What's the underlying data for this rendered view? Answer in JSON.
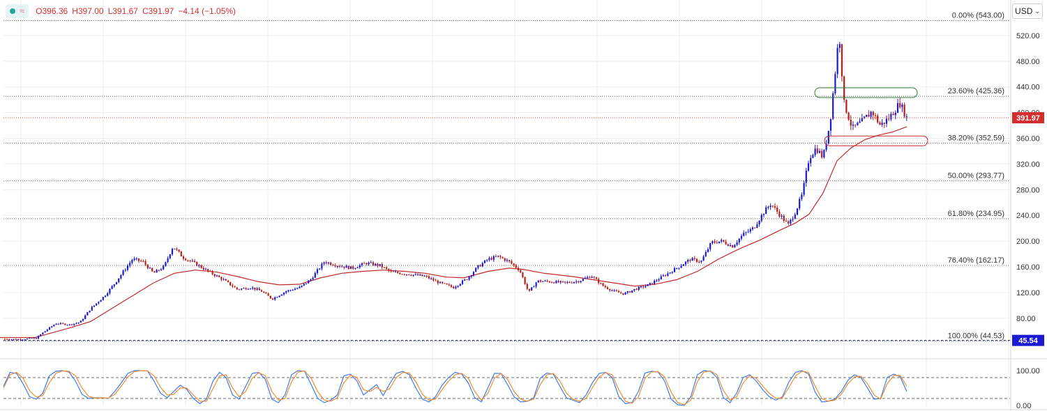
{
  "header": {
    "open": "O396.36",
    "high": "H397.00",
    "low": "L391.67",
    "close": "C391.97",
    "change": "−4.14 (−1.05%)",
    "status_icon": "green-dot-icon",
    "indicator_icon": "wave-icon"
  },
  "currency_selector": {
    "label": "USD"
  },
  "colors": {
    "up_candle": "#1a1ad4",
    "down_candle": "#b71c1c",
    "moving_average": "#c62828",
    "stoch_k": "#3d7bf0",
    "stoch_d": "#f08c2e",
    "price_line": "#d32f2f",
    "grid": "#ececec",
    "fib_line": "#6b6b6b"
  },
  "chart_data": [
    {
      "type": "candlestick",
      "ylim": [
        30,
        560
      ],
      "y_ticks": [
        "520.00",
        "480.00",
        "440.00",
        "400.00",
        "360.00",
        "320.00",
        "280.00",
        "240.00",
        "200.00",
        "160.00",
        "120.00",
        "80.00"
      ],
      "current_price": "391.97",
      "last_close_marker": "45.54",
      "fib_levels": [
        {
          "label": "0.00% (543.00)",
          "value": 543.0
        },
        {
          "label": "23.60% (425.36)",
          "value": 425.36
        },
        {
          "label": "38.20% (352.59)",
          "value": 352.59
        },
        {
          "label": "50.00% (293.77)",
          "value": 293.77
        },
        {
          "label": "61.80% (234.95)",
          "value": 234.95
        },
        {
          "label": "76.40% (162.17)",
          "value": 162.17
        },
        {
          "label": "100.00% (44.53)",
          "value": 44.53
        }
      ],
      "price_path": [
        [
          0,
          48
        ],
        [
          25,
          47
        ],
        [
          52,
          49
        ],
        [
          62,
          58
        ],
        [
          80,
          72
        ],
        [
          100,
          70
        ],
        [
          115,
          74
        ],
        [
          130,
          95
        ],
        [
          150,
          115
        ],
        [
          165,
          135
        ],
        [
          175,
          150
        ],
        [
          190,
          172
        ],
        [
          205,
          168
        ],
        [
          220,
          150
        ],
        [
          235,
          160
        ],
        [
          248,
          192
        ],
        [
          262,
          175
        ],
        [
          280,
          165
        ],
        [
          300,
          152
        ],
        [
          320,
          140
        ],
        [
          340,
          125
        ],
        [
          360,
          128
        ],
        [
          375,
          122
        ],
        [
          390,
          110
        ],
        [
          410,
          122
        ],
        [
          430,
          128
        ],
        [
          445,
          140
        ],
        [
          465,
          168
        ],
        [
          485,
          162
        ],
        [
          505,
          158
        ],
        [
          525,
          166
        ],
        [
          545,
          162
        ],
        [
          560,
          152
        ],
        [
          575,
          150
        ],
        [
          590,
          148
        ],
        [
          610,
          145
        ],
        [
          630,
          135
        ],
        [
          650,
          128
        ],
        [
          670,
          142
        ],
        [
          685,
          160
        ],
        [
          700,
          172
        ],
        [
          715,
          176
        ],
        [
          730,
          168
        ],
        [
          745,
          155
        ],
        [
          758,
          120
        ],
        [
          770,
          138
        ],
        [
          790,
          137
        ],
        [
          810,
          135
        ],
        [
          830,
          138
        ],
        [
          848,
          146
        ],
        [
          865,
          130
        ],
        [
          880,
          122
        ],
        [
          895,
          118
        ],
        [
          910,
          125
        ],
        [
          930,
          132
        ],
        [
          950,
          145
        ],
        [
          970,
          158
        ],
        [
          990,
          172
        ],
        [
          1005,
          168
        ],
        [
          1020,
          198
        ],
        [
          1035,
          200
        ],
        [
          1050,
          192
        ],
        [
          1065,
          210
        ],
        [
          1080,
          220
        ],
        [
          1095,
          245
        ],
        [
          1105,
          258
        ],
        [
          1115,
          245
        ],
        [
          1130,
          225
        ],
        [
          1140,
          245
        ],
        [
          1150,
          272
        ],
        [
          1160,
          330
        ],
        [
          1170,
          345
        ],
        [
          1180,
          330
        ],
        [
          1190,
          385
        ],
        [
          1198,
          470
        ],
        [
          1203,
          525
        ],
        [
          1210,
          415
        ],
        [
          1222,
          375
        ],
        [
          1235,
          385
        ],
        [
          1250,
          402
        ],
        [
          1262,
          380
        ],
        [
          1275,
          392
        ],
        [
          1290,
          415
        ],
        [
          1300,
          392
        ]
      ],
      "moving_average": [
        [
          0,
          50
        ],
        [
          50,
          50
        ],
        [
          100,
          65
        ],
        [
          130,
          75
        ],
        [
          160,
          95
        ],
        [
          190,
          115
        ],
        [
          220,
          135
        ],
        [
          250,
          150
        ],
        [
          280,
          155
        ],
        [
          310,
          152
        ],
        [
          340,
          145
        ],
        [
          370,
          137
        ],
        [
          400,
          132
        ],
        [
          430,
          133
        ],
        [
          460,
          143
        ],
        [
          490,
          150
        ],
        [
          520,
          153
        ],
        [
          550,
          155
        ],
        [
          580,
          153
        ],
        [
          610,
          150
        ],
        [
          640,
          144
        ],
        [
          665,
          143
        ],
        [
          700,
          153
        ],
        [
          730,
          158
        ],
        [
          750,
          156
        ],
        [
          780,
          150
        ],
        [
          820,
          145
        ],
        [
          850,
          140
        ],
        [
          880,
          135
        ],
        [
          910,
          130
        ],
        [
          940,
          133
        ],
        [
          970,
          140
        ],
        [
          1000,
          153
        ],
        [
          1030,
          172
        ],
        [
          1060,
          188
        ],
        [
          1090,
          202
        ],
        [
          1120,
          218
        ],
        [
          1140,
          228
        ],
        [
          1160,
          242
        ],
        [
          1180,
          275
        ],
        [
          1200,
          325
        ],
        [
          1220,
          345
        ],
        [
          1240,
          358
        ],
        [
          1260,
          365
        ],
        [
          1280,
          370
        ],
        [
          1300,
          378
        ]
      ],
      "annotations": [
        {
          "shape": "ellipse",
          "color": "#2e7d32",
          "value": 431,
          "x_from": 1168,
          "x_to": 1315
        },
        {
          "shape": "ellipse",
          "color": "#c62828",
          "value": 356,
          "x_from": 1182,
          "x_to": 1330
        }
      ]
    },
    {
      "type": "line",
      "indicator": "stochastic",
      "ylim": [
        0,
        100
      ],
      "y_ticks": [
        "100.00",
        "0.00"
      ],
      "reference_levels": [
        80,
        20
      ],
      "series": [
        {
          "color": "#3d7bf0",
          "values": [
            55,
            95,
            92,
            62,
            25,
            18,
            35,
            85,
            98,
            100,
            96,
            70,
            32,
            20,
            22,
            22,
            20,
            40,
            65,
            92,
            100,
            100,
            99,
            70,
            35,
            22,
            40,
            58,
            46,
            20,
            5,
            18,
            70,
            95,
            80,
            30,
            18,
            55,
            92,
            95,
            75,
            18,
            8,
            30,
            88,
            100,
            98,
            60,
            20,
            8,
            15,
            30,
            85,
            90,
            70,
            30,
            45,
            60,
            28,
            62,
            92,
            98,
            88,
            50,
            18,
            10,
            25,
            58,
            80,
            95,
            90,
            65,
            22,
            10,
            50,
            92,
            92,
            60,
            25,
            10,
            12,
            22,
            78,
            93,
            90,
            55,
            22,
            15,
            8,
            30,
            66,
            92,
            95,
            80,
            25,
            5,
            8,
            40,
            93,
            98,
            96,
            70,
            18,
            2,
            0,
            25,
            88,
            100,
            98,
            80,
            22,
            8,
            35,
            80,
            88,
            70,
            45,
            25,
            15,
            25,
            68,
            95,
            100,
            90,
            38,
            10,
            12,
            18,
            40,
            72,
            88,
            80,
            50,
            18,
            20,
            80,
            90,
            82,
            40
          ]
        },
        {
          "color": "#f08c2e",
          "values": [
            50,
            88,
            95,
            78,
            42,
            24,
            28,
            65,
            92,
            99,
            98,
            85,
            50,
            26,
            21,
            22,
            21,
            32,
            55,
            82,
            97,
            100,
            99,
            85,
            52,
            30,
            32,
            50,
            50,
            30,
            12,
            12,
            48,
            85,
            88,
            50,
            25,
            40,
            78,
            94,
            85,
            40,
            15,
            20,
            68,
            96,
            99,
            78,
            40,
            15,
            12,
            22,
            65,
            87,
            80,
            45,
            40,
            52,
            40,
            48,
            80,
            95,
            93,
            68,
            32,
            15,
            18,
            45,
            70,
            88,
            92,
            78,
            40,
            15,
            35,
            78,
            92,
            75,
            40,
            18,
            12,
            18,
            60,
            88,
            92,
            70,
            35,
            18,
            12,
            20,
            52,
            82,
            94,
            88,
            45,
            12,
            6,
            25,
            78,
            96,
            97,
            82,
            38,
            8,
            2,
            15,
            68,
            96,
            99,
            88,
            42,
            15,
            25,
            65,
            85,
            78,
            55,
            35,
            20,
            22,
            52,
            85,
            98,
            95,
            55,
            20,
            12,
            15,
            32,
            62,
            82,
            84,
            62,
            30,
            18,
            62,
            86,
            86,
            55
          ]
        }
      ]
    }
  ]
}
